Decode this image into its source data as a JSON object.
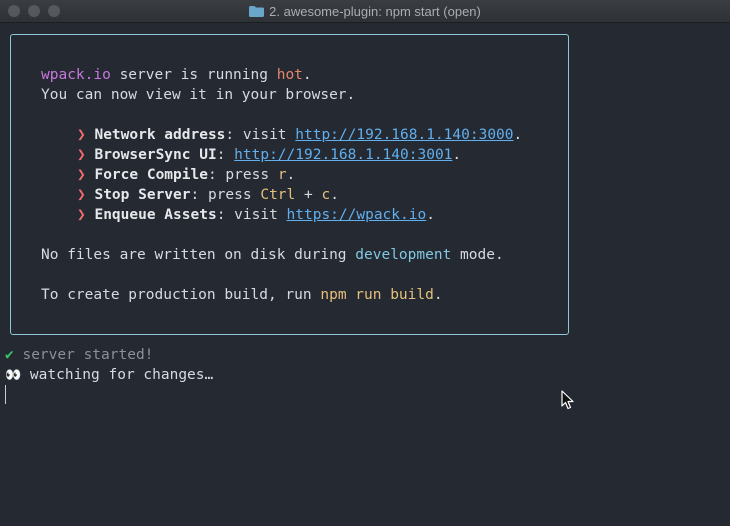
{
  "window": {
    "title": "2. awesome-plugin: npm start (open)",
    "icon": "folder-icon"
  },
  "box": {
    "l1": {
      "brand": "wpack.io",
      "middle": " server is running ",
      "hot": "hot",
      "end": "."
    },
    "l2": "You can now view it in your browser.",
    "items": [
      {
        "label": "Network address",
        "pre": ": visit ",
        "value": "http://192.168.1.140:3000",
        "post": "."
      },
      {
        "label": "BrowserSync UI",
        "pre": ": ",
        "value": "http://192.168.1.140:3001",
        "post": "."
      },
      {
        "label": "Force Compile",
        "pre": ": press ",
        "value": "r",
        "post": "."
      },
      {
        "label": "Stop Server",
        "pre": ": press ",
        "value": "Ctrl",
        "mid": " + ",
        "value2": "c",
        "post": "."
      },
      {
        "label": "Enqueue Assets",
        "pre": ": visit ",
        "value": "https://wpack.io",
        "post": "."
      }
    ],
    "bullet": "❯",
    "l3": {
      "pre": "No files are written on disk during ",
      "keyword": "development",
      "post": " mode."
    },
    "l4": {
      "pre": "To create production build, run ",
      "cmd": "npm run build",
      "post": "."
    }
  },
  "status": {
    "check": "✔",
    "started": " server started!",
    "eyes": "👀",
    "watching": " watching for changes…"
  },
  "colors": {
    "border": "#8fc7d8",
    "accent_link": "#61afef",
    "background": "#252931"
  }
}
